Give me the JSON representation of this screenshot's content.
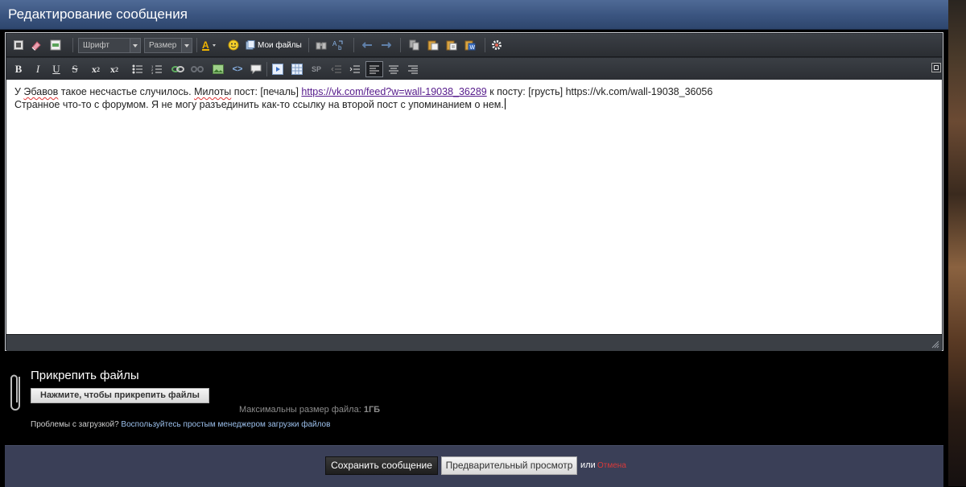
{
  "window": {
    "title": "Редактирование сообщения"
  },
  "toolbar": {
    "font_label": "Шрифт",
    "size_label": "Размер",
    "my_files_label": "Мои файлы",
    "strip_label": "SP"
  },
  "editor": {
    "line1": {
      "p1": "У ",
      "w1": "Эбавов",
      "p2": " такое несчастье случилось. ",
      "w2": "Милоты",
      "p3": " пост: [печаль] ",
      "link1": "https://vk.com/feed?w=wall-19038_36289",
      "p4": " к посту: [грусть] https://vk.com/wall-19038_36056"
    },
    "line2": "Странное что-то с форумом. Я не могу разъединить как-то ссылку на второй пост с упоминанием о нем."
  },
  "attachments": {
    "title": "Прикрепить файлы",
    "button_label": "Нажмите, чтобы прикрепить файлы",
    "max_size_label": "Максимальны размер файла:",
    "max_size_value": "1ГБ",
    "problems_text": "Проблемы с загрузкой?",
    "simple_uploader_link": "Воспользуйтесь простым менеджером загрузки файлов"
  },
  "footer": {
    "save_label": "Сохранить сообщение",
    "preview_label": "Предварительный просмотр",
    "or_text": "или",
    "cancel_label": "Отмена"
  },
  "colors": {
    "title_bar": "#3a547f",
    "footer_bar": "#3a3f57",
    "link": "#551a8b",
    "cancel": "#d93a3a",
    "secondary_link": "#9cc0ec"
  }
}
